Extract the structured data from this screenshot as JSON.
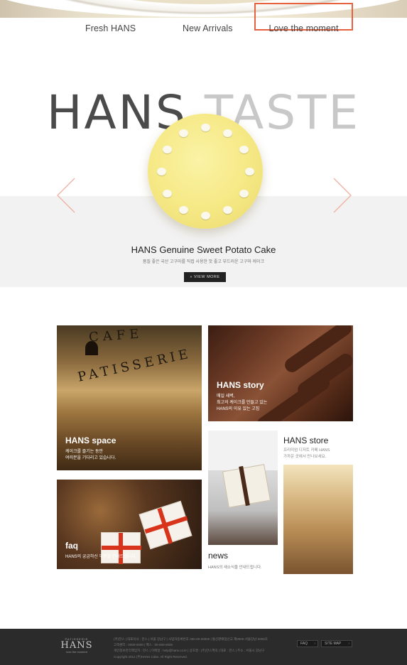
{
  "nav": {
    "items": [
      {
        "label": "Fresh HANS"
      },
      {
        "label": "New Arrivals"
      },
      {
        "label": "Love the moment"
      }
    ],
    "highlight_color": "#e8613f"
  },
  "hero": {
    "title_part1": "HANS",
    "title_part2": "TASTE",
    "product_name": "HANS Genuine Sweet Potato Cake",
    "product_desc": "품질 좋은 국산 고구마를 직접 사용한 맛 좋고 부드러운 고구마 케이크",
    "view_more": "» VIEW MORE",
    "prev_icon": "chevron-left-icon",
    "next_icon": "chevron-right-icon"
  },
  "tiles": {
    "space": {
      "title": "HANS space",
      "line1": "케이크를 즐기는 동안",
      "line2": "여러분을 기다리고 있습니다.",
      "deco1": "CAFE",
      "deco2": "PATISSERIE"
    },
    "story": {
      "title": "HANS story",
      "line1": "매일 새벽,",
      "line2": "최고의 케이크를 만들고 있는",
      "line3": "HANS의 이유 있는 고집"
    },
    "faq": {
      "title": "faq",
      "line1": "HANS의 궁금하신 부분을 안내드립니다."
    },
    "news": {
      "title": "news",
      "line1": "HANS의 새소식을 안내드립니다."
    },
    "store": {
      "title": "HANS store",
      "line1": "프리미엄 디저트 카페 HANS",
      "line2": "가까운 곳에서 만나보세요."
    }
  },
  "footer": {
    "logo_top": "PATISSERIE",
    "logo_main": "HANS",
    "logo_tag": "love the moment",
    "lines": [
      "(주)한스 | 대표이사 : 한스 | 서울 강남구 | 사업자등록번호 000-00-00000 | 통신판매업신고 제0000-서울강남-0000호",
      "고객센터 : 0000-0000 | 팩스 : 00-000-0000",
      "개인정보관리책임자 : 한스 | 이메일 : help@hans.co.kr | 상호명 : (주)한스케익 | 대표 : 한스 | 주소 : 서울시 강남구",
      "Copyright 2012 (주)HANS Cake. All Right Reserved."
    ],
    "faq_btn": "FAQ",
    "sitemap_btn": "SITE MAP"
  }
}
